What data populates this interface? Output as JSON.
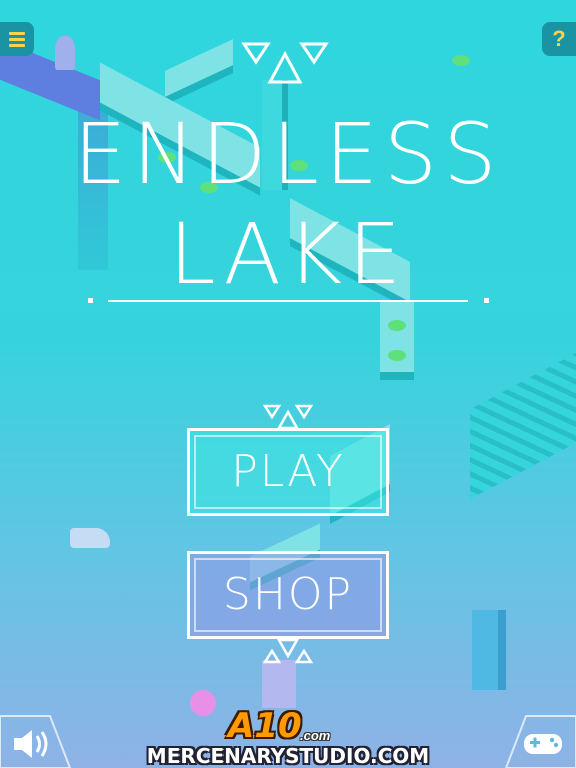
{
  "header": {
    "menu_icon": "menu-icon",
    "help_label": "?"
  },
  "title": {
    "line1": "ENDLESS",
    "line2": "LAKE"
  },
  "menu": {
    "play_label": "PLAY",
    "shop_label": "SHOP"
  },
  "footer": {
    "sound_icon": "speaker-icon",
    "gamepad_icon": "gamepad-icon",
    "sponsor_logo": "A10",
    "sponsor_suffix": ".com",
    "studio": "MERCENARYSTUDIO.COM"
  },
  "colors": {
    "accent": "#ffd24a",
    "button_bg": "#1a93a2",
    "water": "#37d3dc"
  }
}
